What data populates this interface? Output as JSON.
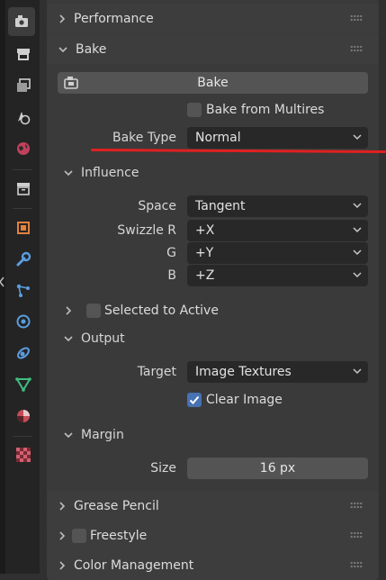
{
  "panels": {
    "performance": "Performance",
    "bake": "Bake",
    "grease_pencil": "Grease Pencil",
    "freestyle": "Freestyle",
    "color_management": "Color Management"
  },
  "bake": {
    "bake_button": "Bake",
    "bake_from_multires": "Bake from Multires",
    "bake_from_multires_checked": false,
    "bake_type_label": "Bake Type",
    "bake_type_value": "Normal"
  },
  "influence": {
    "title": "Influence",
    "space_label": "Space",
    "space_value": "Tangent",
    "swizzle_r_label": "Swizzle R",
    "swizzle_r_value": "+X",
    "g_label": "G",
    "g_value": "+Y",
    "b_label": "B",
    "b_value": "+Z"
  },
  "selected_to_active": {
    "title": "Selected to Active",
    "checked": false
  },
  "output": {
    "title": "Output",
    "target_label": "Target",
    "target_value": "Image Textures",
    "clear_image": "Clear Image",
    "clear_image_checked": true
  },
  "margin": {
    "title": "Margin",
    "size_label": "Size",
    "size_value": "16 px"
  },
  "freestyle_checked": false,
  "sidebar_tabs": [
    "render-properties-icon",
    "output-properties-icon",
    "view-layer-icon",
    "scene-icon",
    "world-icon",
    "collection-icon",
    "object-icon",
    "modifier-icon",
    "particles-icon",
    "physics-icon",
    "constraints-icon",
    "object-data-icon",
    "material-icon",
    "texture-icon"
  ],
  "colors": {
    "accent": "#4772b3",
    "annotation_red": "#e02020"
  }
}
